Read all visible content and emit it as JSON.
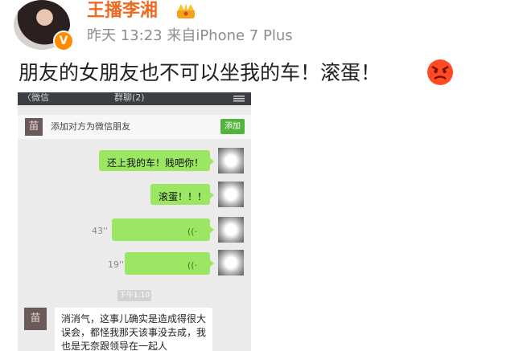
{
  "post": {
    "username": "王播李湘",
    "verified_badge": "V",
    "meta": "昨天 13:23  来自iPhone 7 Plus",
    "text": "朋友的女朋友也不可以坐我的车！滚蛋！",
    "icons": {
      "crown": "crown-icon",
      "emoji": "angry-face-icon"
    }
  },
  "chat": {
    "topbar": {
      "back": "〈微信",
      "title": "群聊(2)"
    },
    "add_friend": {
      "avatar": "苗",
      "text": "添加对方为微信朋友",
      "button": "添加"
    },
    "messages": [
      {
        "type": "text",
        "text": "还上我的车！贱吧你！"
      },
      {
        "type": "text",
        "text": "滚蛋！！！"
      },
      {
        "type": "voice",
        "duration": "43''"
      },
      {
        "type": "voice",
        "duration": "19''"
      }
    ],
    "time_separator": "下午1:10",
    "incoming": {
      "avatar": "苗",
      "text": "消消气，这事儿确实是造成得很大误会，都怪我那天该事没去成，我也是无奈跟领导在一起人"
    }
  },
  "colors": {
    "brand_orange": "#ee6a1f",
    "wechat_green": "#9be764",
    "add_button_green": "#52b43d"
  }
}
